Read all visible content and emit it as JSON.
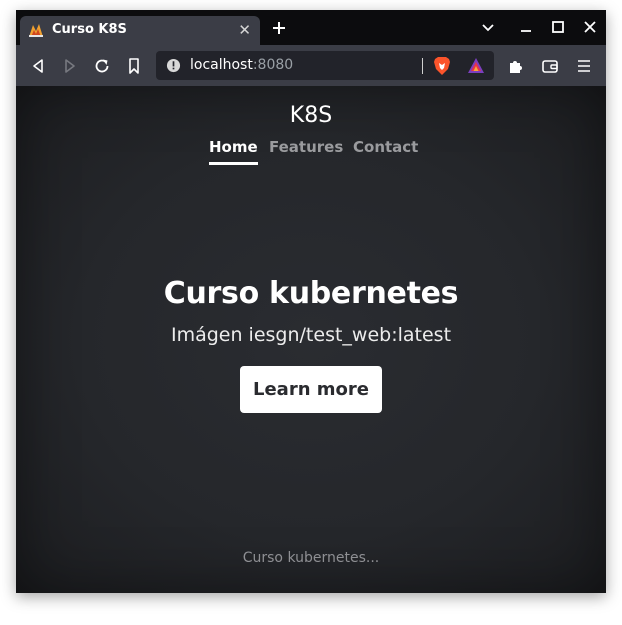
{
  "browser": {
    "tab": {
      "title": "Curso K8S",
      "favicon": "k8s-flame-icon",
      "close_glyph": "✕"
    },
    "new_tab_icon": "plus-icon",
    "window_controls": [
      "chevron-down-icon",
      "minimize-icon",
      "maximize-icon",
      "close-icon"
    ],
    "toolbar": {
      "back_icon": "back-icon",
      "forward_icon": "forward-icon",
      "reload_icon": "reload-icon",
      "bookmark_icon": "bookmark-icon",
      "url_host": "localhost",
      "url_port": ":8080",
      "extensions_icon": "puzzle-icon",
      "wallet_icon": "wallet-icon",
      "menu_icon": "hamburger-icon"
    }
  },
  "page": {
    "brand": "K8S",
    "nav": [
      {
        "label": "Home",
        "active": true
      },
      {
        "label": "Features",
        "active": false
      },
      {
        "label": "Contact",
        "active": false
      }
    ],
    "hero_title": "Curso kubernetes",
    "hero_subtitle": "Imágen iesgn/test_web:latest",
    "cta_label": "Learn more",
    "footer_text": "Curso kubernetes..."
  },
  "colors": {
    "tabstrip_bg": "#0c0c0e",
    "toolbar_bg": "#3b3d46",
    "page_bg": "#25272b",
    "brave_orange": "#fb542b"
  }
}
